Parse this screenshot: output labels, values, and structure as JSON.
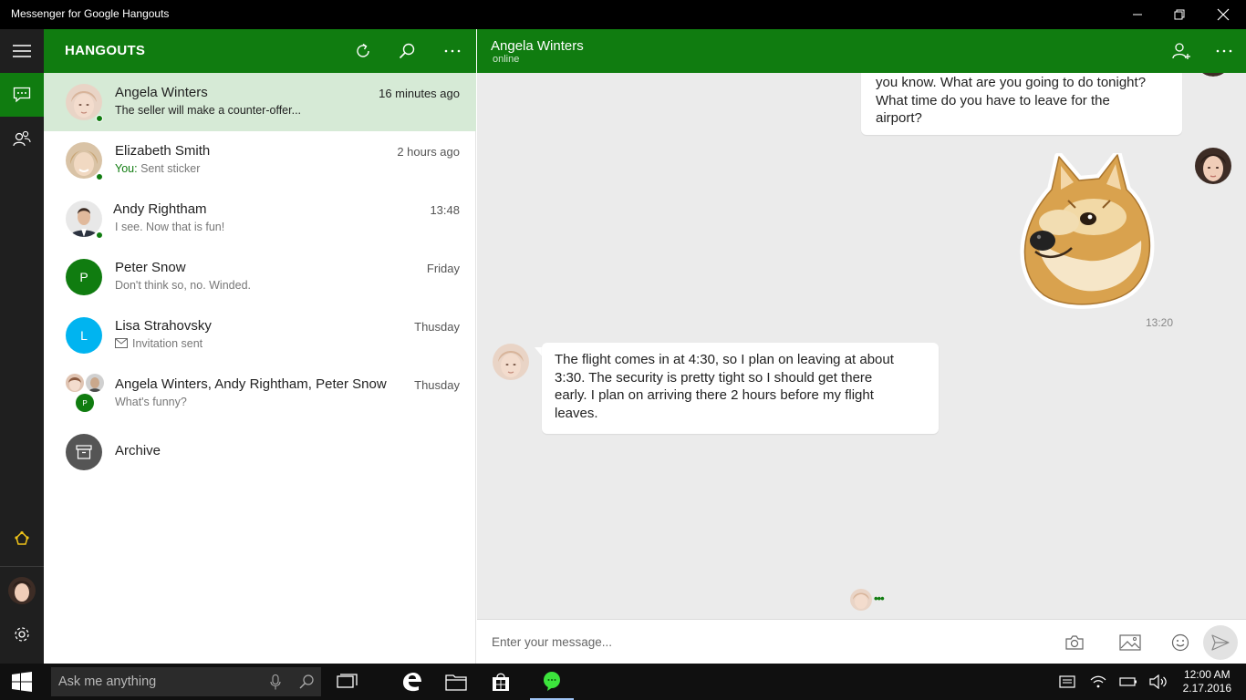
{
  "window": {
    "title": "Messenger for Google Hangouts"
  },
  "list": {
    "header": "HANGOUTS",
    "conversations": [
      {
        "name": "Angela Winters",
        "preview": "The seller will make a counter-offer...",
        "time": "16 minutes ago",
        "online": true
      },
      {
        "name": "Elizabeth Smith",
        "preview_prefix": "You:",
        "preview": "Sent sticker",
        "time": "2 hours ago",
        "online": true
      },
      {
        "name": "Andy Rightham",
        "preview": "I see. Now that is fun!",
        "time": "13:48",
        "online": true
      },
      {
        "name": "Peter Snow",
        "initial": "P",
        "avatar_color": "#107c10",
        "preview": "Don't think so, no. Winded.",
        "time": "Friday"
      },
      {
        "name": "Lisa Strahovsky",
        "initial": "L",
        "avatar_color": "#00b4f0",
        "preview": "Invitation sent",
        "time": "Thusday"
      },
      {
        "name": "Angela Winters, Andy Rightham, Peter Snow",
        "group_initial": "P",
        "preview": "What's funny?",
        "time": "Thusday"
      }
    ],
    "archive_label": "Archive"
  },
  "chat": {
    "contact_name": "Angela Winters",
    "contact_status": "online",
    "messages": [
      {
        "sender": "me",
        "lines": [
          "you know. What are you going to do tonight?",
          "What time do you have to leave for the",
          "airport?"
        ]
      },
      {
        "sender": "me",
        "type": "sticker",
        "sticker": "doge-sticker",
        "time": "13:20"
      },
      {
        "sender": "contact",
        "lines": [
          "The flight comes in at 4:30, so I plan on leaving at about",
          "3:30. The security is pretty tight so I should get there",
          "early.  I plan on arriving there 2 hours before my flight",
          "leaves."
        ]
      }
    ],
    "typing_indicator": "•••",
    "composer_placeholder": "Enter your message..."
  },
  "taskbar": {
    "search_placeholder": "Ask me anything",
    "clock_time": "12:00 AM",
    "clock_date": "2.17.2016"
  },
  "colors": {
    "accent": "#107c10",
    "rail": "#1f1f1f",
    "selected_row": "#d6ead6",
    "chat_bg": "#ebebeb"
  }
}
